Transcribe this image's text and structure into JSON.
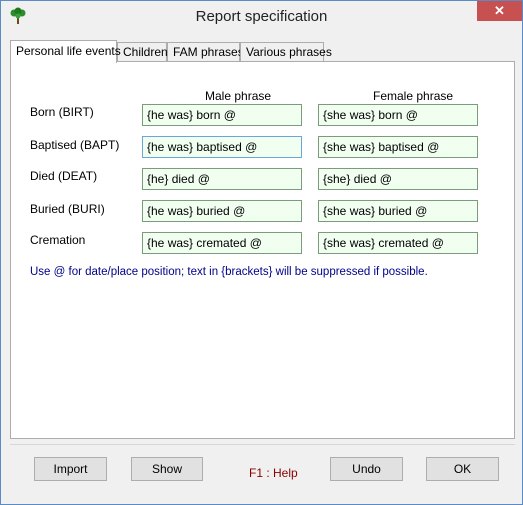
{
  "window": {
    "title": "Report specification",
    "icon": "tree-icon",
    "close_glyph": "✕"
  },
  "tabs": [
    {
      "label": "Personal life events",
      "active": true
    },
    {
      "label": "Children",
      "active": false
    },
    {
      "label": "FAM phrases",
      "active": false
    },
    {
      "label": "Various phrases",
      "active": false
    }
  ],
  "columns": {
    "male": "Male phrase",
    "female": "Female phrase"
  },
  "rows": [
    {
      "label": "Born (BIRT)",
      "male": "{he was} born @",
      "female": "{she was} born @"
    },
    {
      "label": "Baptised (BAPT)",
      "male": "{he was} baptised @",
      "female": "{she was} baptised @"
    },
    {
      "label": "Died (DEAT)",
      "male": "{he} died @",
      "female": "{she} died @"
    },
    {
      "label": "Buried (BURI)",
      "male": "{he was} buried @",
      "female": "{she was} buried @"
    },
    {
      "label": "Cremation",
      "male": "{he was} cremated @",
      "female": "{she was} cremated @"
    }
  ],
  "hint": "Use @ for date/place position; text in {brackets} will be suppressed if possible.",
  "buttons": {
    "import": "Import",
    "show": "Show",
    "undo": "Undo",
    "ok": "OK"
  },
  "help": "F1 : Help",
  "colors": {
    "field_bg": "#f0fff0",
    "hint": "#00008b",
    "help": "#8b0000",
    "close": "#c75050"
  }
}
